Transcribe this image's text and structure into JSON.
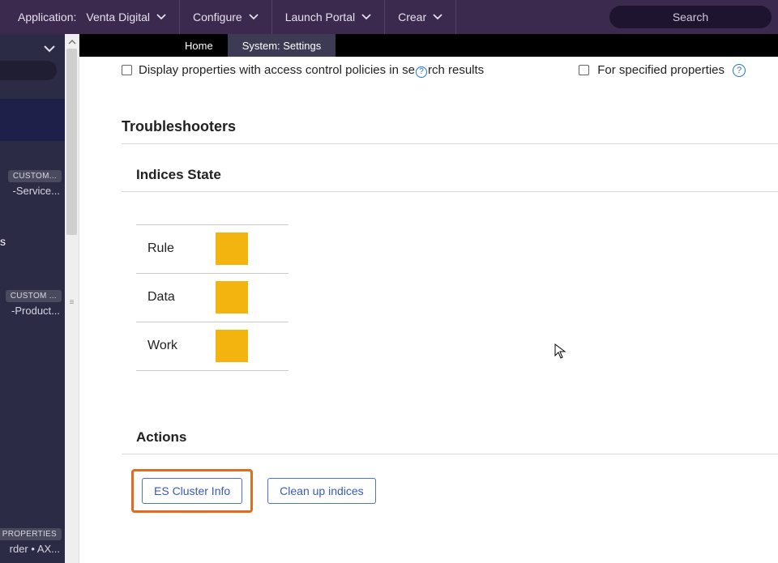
{
  "topbar": {
    "app_label": "Application:",
    "app_name": "Venta Digital",
    "menu": {
      "configure": "Configure",
      "launch": "Launch Portal",
      "create": "Crear"
    },
    "search_placeholder": "Search"
  },
  "tabs": {
    "home": "Home",
    "settings": "System: Settings"
  },
  "sidebar": {
    "group1_badge": "CUSTOM...",
    "group1_text": "-Service...",
    "s_label": "s",
    "group2_badge": "CUSTOM ...",
    "group2_text": "-Product...",
    "group3_badge": "PROPERTIES",
    "group3_text": "rder • AX..."
  },
  "settings": {
    "checkbox1_label_pre": "Display properties with access control policies in se",
    "checkbox1_label_post": "rch results",
    "checkbox2_label": "For specified properties",
    "section_title": "Troubleshooters",
    "indices_title": "Indices State",
    "indices": [
      {
        "label": "Rule",
        "color": "#f4b40f"
      },
      {
        "label": "Data",
        "color": "#f4b40f"
      },
      {
        "label": "Work",
        "color": "#f4b40f"
      }
    ],
    "actions_title": "Actions",
    "buttons": {
      "es_cluster": "ES Cluster Info",
      "cleanup": "Clean up indices"
    }
  }
}
